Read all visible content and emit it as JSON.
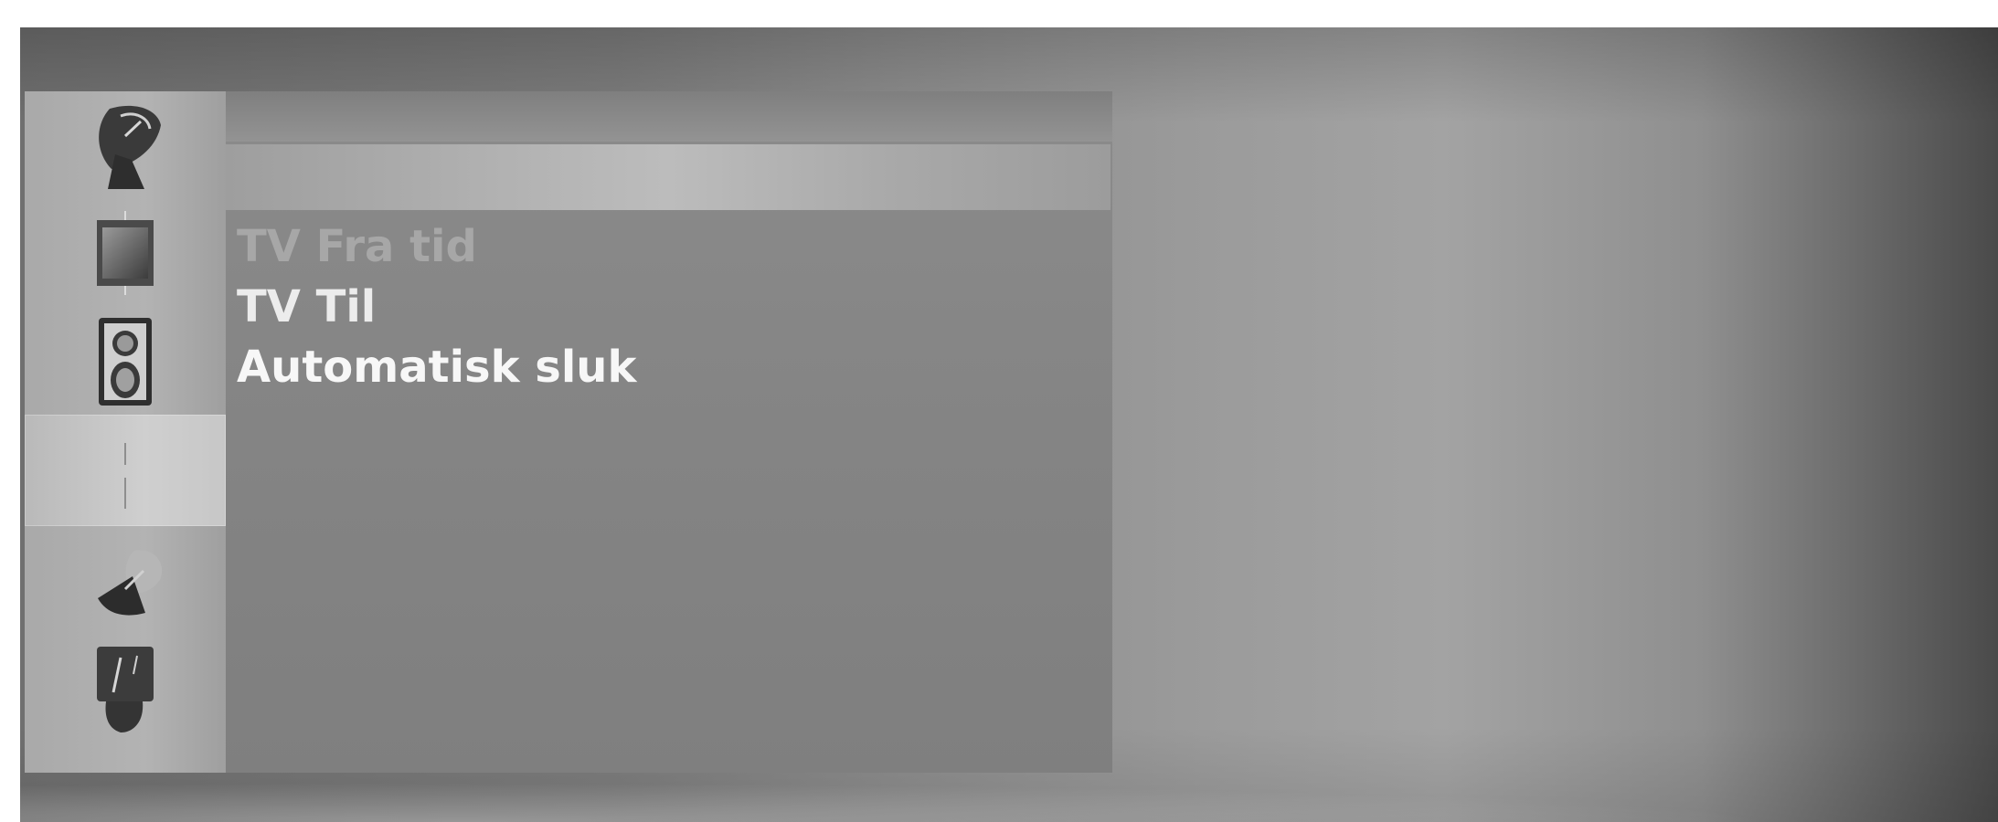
{
  "menu": {
    "items": [
      {
        "label": "TV Fra tid",
        "state": "dim"
      },
      {
        "label": "TV Til",
        "state": "normal"
      },
      {
        "label": "Automatisk sluk",
        "state": "active"
      }
    ]
  },
  "sidebar": {
    "icons": [
      {
        "name": "satellite-dish-icon",
        "selected": false
      },
      {
        "name": "tv-screen-icon",
        "selected": false
      },
      {
        "name": "speaker-icon",
        "selected": false
      },
      {
        "name": "clock-icon",
        "selected": true
      },
      {
        "name": "settings-dish-icon",
        "selected": false
      },
      {
        "name": "lock-icon",
        "selected": false
      }
    ]
  },
  "colors": {
    "text_active": "#f7f7f7",
    "text_dim": "#a7a7a7",
    "highlight": "#bcbcbc"
  }
}
